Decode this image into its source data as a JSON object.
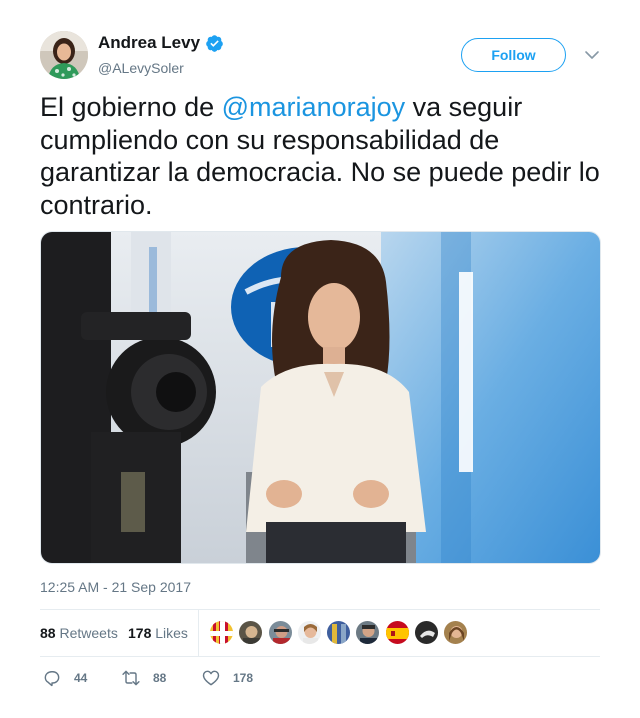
{
  "author": {
    "name": "Andrea Levy",
    "handle": "@ALevySoler",
    "verified": true,
    "avatar_icon": "profile-photo"
  },
  "follow_label": "Follow",
  "tweet": {
    "text_before": "El gobierno de ",
    "mention": "@marianorajoy",
    "text_after": " va seguir cumpliendo con su responsabilidad de garantizar la democracia. No se puede pedir lo contrario."
  },
  "media": {
    "type": "photo",
    "icon": "interview-photo"
  },
  "timestamp": "12:25 AM - 21 Sep 2017",
  "stats": {
    "retweets_count": "88",
    "retweets_label": "Retweets",
    "likes_count": "178",
    "likes_label": "Likes"
  },
  "liker_avatars": [
    "avatar-1",
    "avatar-2",
    "avatar-3",
    "avatar-4",
    "avatar-5",
    "avatar-6",
    "avatar-7",
    "avatar-8",
    "avatar-9"
  ],
  "actions": {
    "reply_count": "44",
    "retweet_count": "88",
    "like_count": "178"
  },
  "colors": {
    "accent": "#1da1f2",
    "mention": "#1b95e0",
    "text": "#14171a",
    "muted": "#657786"
  }
}
